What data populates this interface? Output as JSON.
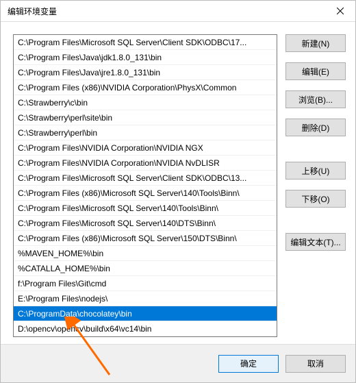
{
  "window": {
    "title": "编辑环境变量"
  },
  "list": {
    "selected_index": 18,
    "items": [
      "C:\\Program Files\\Microsoft SQL Server\\Client SDK\\ODBC\\17...",
      "C:\\Program Files\\Java\\jdk1.8.0_131\\bin",
      "C:\\Program Files\\Java\\jre1.8.0_131\\bin",
      "C:\\Program Files (x86)\\NVIDIA Corporation\\PhysX\\Common",
      "C:\\Strawberry\\c\\bin",
      "C:\\Strawberry\\perl\\site\\bin",
      "C:\\Strawberry\\perl\\bin",
      "C:\\Program Files\\NVIDIA Corporation\\NVIDIA NGX",
      "C:\\Program Files\\NVIDIA Corporation\\NVIDIA NvDLISR",
      "C:\\Program Files\\Microsoft SQL Server\\Client SDK\\ODBC\\13...",
      "C:\\Program Files (x86)\\Microsoft SQL Server\\140\\Tools\\Binn\\",
      "C:\\Program Files\\Microsoft SQL Server\\140\\Tools\\Binn\\",
      "C:\\Program Files\\Microsoft SQL Server\\140\\DTS\\Binn\\",
      "C:\\Program Files (x86)\\Microsoft SQL Server\\150\\DTS\\Binn\\",
      "%MAVEN_HOME%\\bin",
      "%CATALLA_HOME%\\bin",
      "f:\\Program Files\\Git\\cmd",
      "E:\\Program Files\\nodejs\\",
      "C:\\ProgramData\\chocolatey\\bin",
      "D:\\opencv\\opencv\\build\\x64\\vc14\\bin"
    ]
  },
  "buttons": {
    "new": "新建(N)",
    "edit": "编辑(E)",
    "browse": "浏览(B)...",
    "delete": "删除(D)",
    "move_up": "上移(U)",
    "move_down": "下移(O)",
    "edit_text": "编辑文本(T)...",
    "ok": "确定",
    "cancel": "取消"
  }
}
